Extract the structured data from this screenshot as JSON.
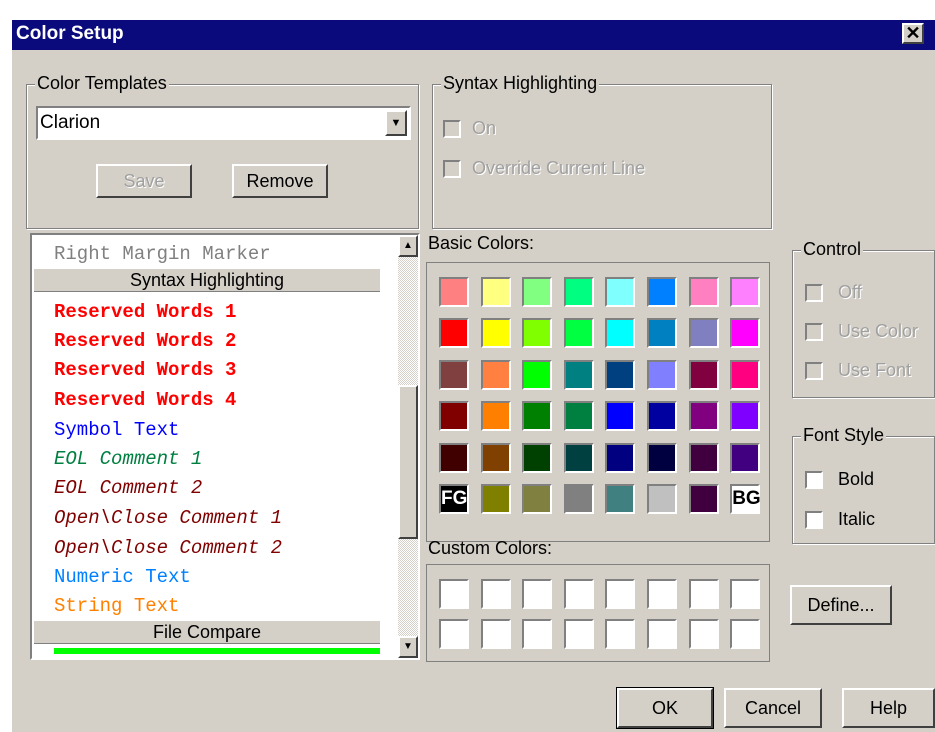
{
  "window": {
    "title": "Color Setup",
    "close_glyph": "✕"
  },
  "templates": {
    "legend": "Color Templates",
    "selected": "Clarion",
    "save_label": "Save",
    "remove_label": "Remove"
  },
  "syntax": {
    "legend": "Syntax Highlighting",
    "on_label": "On",
    "override_label": "Override Current Line"
  },
  "items": {
    "margin": "Right Margin Marker",
    "hdr_syntax": "Syntax Highlighting",
    "rw1": "Reserved Words 1",
    "rw2": "Reserved Words 2",
    "rw3": "Reserved Words 3",
    "rw4": "Reserved Words 4",
    "symbol": "Symbol Text",
    "eol1": "EOL Comment 1",
    "eol2": "EOL Comment 2",
    "oc1": "Open\\Close Comment 1",
    "oc2": "Open\\Close Comment 2",
    "numeric": "Numeric Text",
    "string": "String Text",
    "hdr_compare": "File Compare"
  },
  "item_colors": {
    "margin": "#808080",
    "reserved": "#ff0000",
    "symbol": "#0000ff",
    "eol1": "#008040",
    "eol2": "#800000",
    "oc": "#800000",
    "numeric": "#0080ff",
    "string": "#ff8000",
    "compare_bar": "#00ff00"
  },
  "basic": {
    "label": "Basic Colors:",
    "fg_label": "FG",
    "bg_label": "BG",
    "colors": [
      "#ff8080",
      "#ffff80",
      "#80ff80",
      "#00ff80",
      "#80ffff",
      "#0080ff",
      "#ff80c0",
      "#ff80ff",
      "#ff0000",
      "#ffff00",
      "#80ff00",
      "#00ff40",
      "#00ffff",
      "#0080c0",
      "#8080c0",
      "#ff00ff",
      "#804040",
      "#ff8040",
      "#00ff00",
      "#008080",
      "#004080",
      "#8080ff",
      "#800040",
      "#ff0080",
      "#800000",
      "#ff8000",
      "#008000",
      "#008040",
      "#0000ff",
      "#0000a0",
      "#800080",
      "#8000ff",
      "#400000",
      "#804000",
      "#004000",
      "#004040",
      "#000080",
      "#000040",
      "#400040",
      "#400080",
      "#000000",
      "#808000",
      "#808040",
      "#808080",
      "#408080",
      "#c0c0c0",
      "#400040",
      "#ffffff"
    ]
  },
  "custom": {
    "label": "Custom Colors:"
  },
  "control": {
    "legend": "Control",
    "off": "Off",
    "use_color": "Use Color",
    "use_font": "Use Font"
  },
  "fontstyle": {
    "legend": "Font Style",
    "bold": "Bold",
    "italic": "Italic"
  },
  "buttons": {
    "define": "Define...",
    "ok": "OK",
    "cancel": "Cancel",
    "help": "Help"
  }
}
